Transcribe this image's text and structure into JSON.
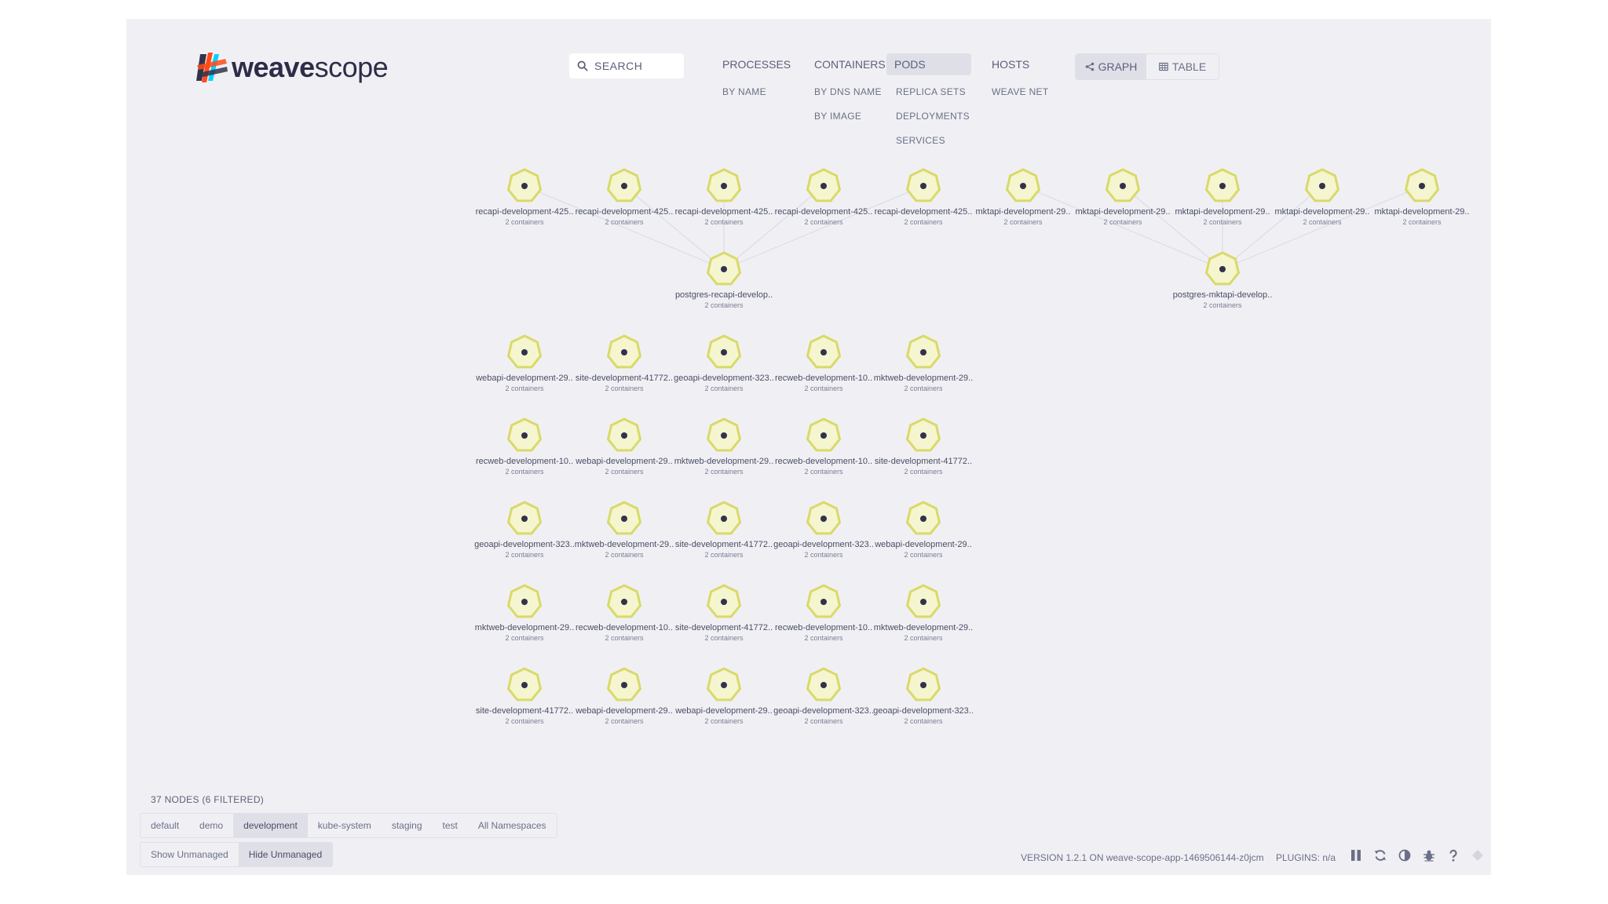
{
  "app": {
    "logo_part1": "weave",
    "logo_part2": "scope"
  },
  "search": {
    "placeholder": "SEARCH"
  },
  "topology": {
    "processes": {
      "label": "PROCESSES",
      "sub": [
        "BY NAME"
      ]
    },
    "containers": {
      "label": "CONTAINERS",
      "sub": [
        "BY DNS NAME",
        "BY IMAGE"
      ]
    },
    "pods": {
      "label": "PODS",
      "sub": [
        "REPLICA SETS",
        "DEPLOYMENTS",
        "SERVICES"
      ],
      "active": true
    },
    "hosts": {
      "label": "HOSTS",
      "sub": [
        "WEAVE NET"
      ]
    }
  },
  "view_toggle": {
    "graph_label": "GRAPH",
    "table_label": "TABLE",
    "active": "graph"
  },
  "graph": {
    "node_color": "#d9d96a",
    "node_fill": "#f5f5cf",
    "nodes": [
      {
        "label": "recapi-development-425..",
        "sub": "2 containers"
      },
      {
        "label": "recapi-development-425..",
        "sub": "2 containers"
      },
      {
        "label": "recapi-development-425..",
        "sub": "2 containers"
      },
      {
        "label": "recapi-development-425..",
        "sub": "2 containers"
      },
      {
        "label": "recapi-development-425..",
        "sub": "2 containers"
      },
      {
        "label": "mktapi-development-29..",
        "sub": "2 containers"
      },
      {
        "label": "mktapi-development-29..",
        "sub": "2 containers"
      },
      {
        "label": "mktapi-development-29..",
        "sub": "2 containers"
      },
      {
        "label": "mktapi-development-29..",
        "sub": "2 containers"
      },
      {
        "label": "mktapi-development-29..",
        "sub": "2 containers"
      },
      {
        "label": "postgres-recapi-develop..",
        "sub": "2 containers"
      },
      {
        "label": "postgres-mktapi-develop..",
        "sub": "2 containers"
      },
      {
        "label": "webapi-development-29..",
        "sub": "2 containers"
      },
      {
        "label": "site-development-41772..",
        "sub": "2 containers"
      },
      {
        "label": "geoapi-development-323..",
        "sub": "2 containers"
      },
      {
        "label": "recweb-development-10..",
        "sub": "2 containers"
      },
      {
        "label": "mktweb-development-29..",
        "sub": "2 containers"
      },
      {
        "label": "recweb-development-10..",
        "sub": "2 containers"
      },
      {
        "label": "webapi-development-29..",
        "sub": "2 containers"
      },
      {
        "label": "mktweb-development-29..",
        "sub": "2 containers"
      },
      {
        "label": "recweb-development-10..",
        "sub": "2 containers"
      },
      {
        "label": "site-development-41772..",
        "sub": "2 containers"
      },
      {
        "label": "geoapi-development-323..",
        "sub": "2 containers"
      },
      {
        "label": "mktweb-development-29..",
        "sub": "2 containers"
      },
      {
        "label": "site-development-41772..",
        "sub": "2 containers"
      },
      {
        "label": "geoapi-development-323..",
        "sub": "2 containers"
      },
      {
        "label": "webapi-development-29..",
        "sub": "2 containers"
      },
      {
        "label": "mktweb-development-29..",
        "sub": "2 containers"
      },
      {
        "label": "recweb-development-10..",
        "sub": "2 containers"
      },
      {
        "label": "site-development-41772..",
        "sub": "2 containers"
      },
      {
        "label": "recweb-development-10..",
        "sub": "2 containers"
      },
      {
        "label": "mktweb-development-29..",
        "sub": "2 containers"
      },
      {
        "label": "site-development-41772..",
        "sub": "2 containers"
      },
      {
        "label": "webapi-development-29..",
        "sub": "2 containers"
      },
      {
        "label": "webapi-development-29..",
        "sub": "2 containers"
      },
      {
        "label": "geoapi-development-323..",
        "sub": "2 containers"
      },
      {
        "label": "geoapi-development-323..",
        "sub": "2 containers"
      }
    ]
  },
  "footer": {
    "node_count": "37 NODES (6 FILTERED)",
    "namespaces": [
      "default",
      "demo",
      "development",
      "kube-system",
      "staging",
      "test",
      "All Namespaces"
    ],
    "active_namespace": "development",
    "unmanaged": [
      "Show Unmanaged",
      "Hide Unmanaged"
    ],
    "active_unmanaged": "Hide Unmanaged",
    "version": "VERSION 1.2.1 ON weave-scope-app-1469506144-z0jcm",
    "plugins": "PLUGINS: n/a",
    "icons": [
      "pause-icon",
      "refresh-icon",
      "contrast-icon",
      "bug-icon",
      "help-icon"
    ]
  }
}
